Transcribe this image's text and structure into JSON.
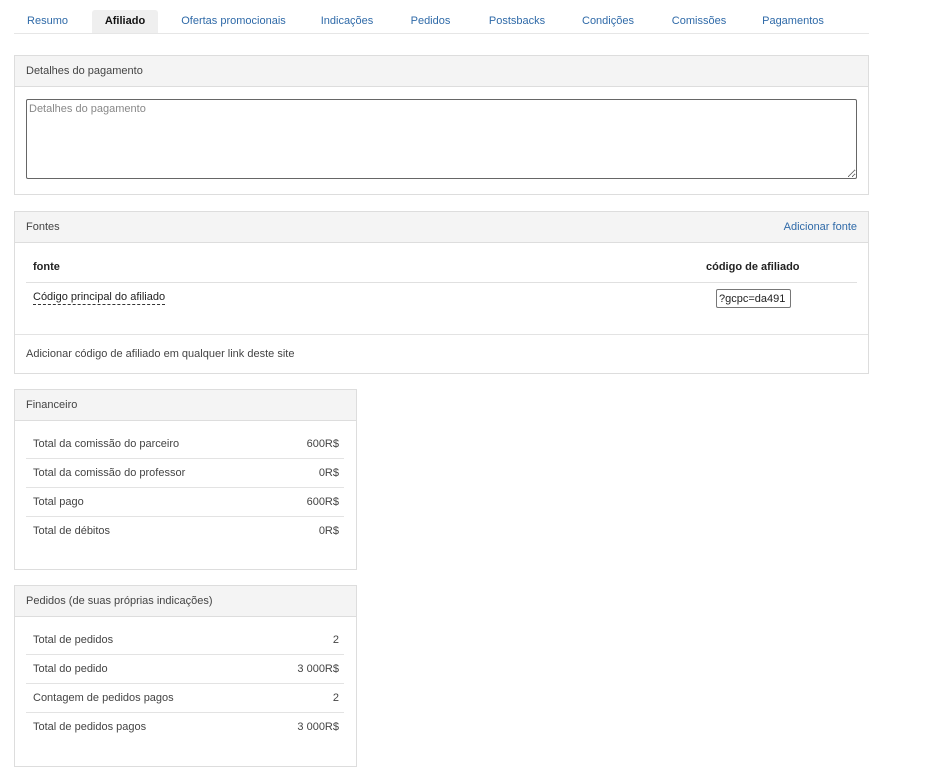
{
  "tabs": [
    {
      "label": "Resumo"
    },
    {
      "label": "Afiliado"
    },
    {
      "label": "Ofertas promocionais"
    },
    {
      "label": "Indicações"
    },
    {
      "label": "Pedidos"
    },
    {
      "label": "Postsbacks"
    },
    {
      "label": "Condições"
    },
    {
      "label": "Comissões"
    },
    {
      "label": "Pagamentos"
    }
  ],
  "active_tab": "Afiliado",
  "payment_details": {
    "title": "Detalhes do pagamento",
    "placeholder": "Detalhes do pagamento",
    "value": ""
  },
  "sources": {
    "title": "Fontes",
    "add_label": "Adicionar fonte",
    "col_source": "fonte",
    "col_code": "código de afiliado",
    "rows": [
      {
        "source": "Código principal do afiliado",
        "code": "?gcpc=da491"
      }
    ],
    "footer": "Adicionar código de afiliado em qualquer link deste site"
  },
  "financial": {
    "title": "Financeiro",
    "rows": [
      {
        "label": "Total da comissão do parceiro",
        "value": "600R$"
      },
      {
        "label": "Total da comissão do professor",
        "value": "0R$"
      },
      {
        "label": "Total pago",
        "value": "600R$"
      },
      {
        "label": "Total de débitos",
        "value": "0R$"
      }
    ]
  },
  "orders": {
    "title": "Pedidos (de suas próprias indicações)",
    "rows": [
      {
        "label": "Total de pedidos",
        "value": "2"
      },
      {
        "label": "Total do pedido",
        "value": "3 000R$"
      },
      {
        "label": "Contagem de pedidos pagos",
        "value": "2"
      },
      {
        "label": "Total de pedidos pagos",
        "value": "3 000R$"
      }
    ]
  },
  "colors": {
    "link": "#2f6aa8",
    "panel_header": "#f4f4f4",
    "border": "#dddddd"
  }
}
